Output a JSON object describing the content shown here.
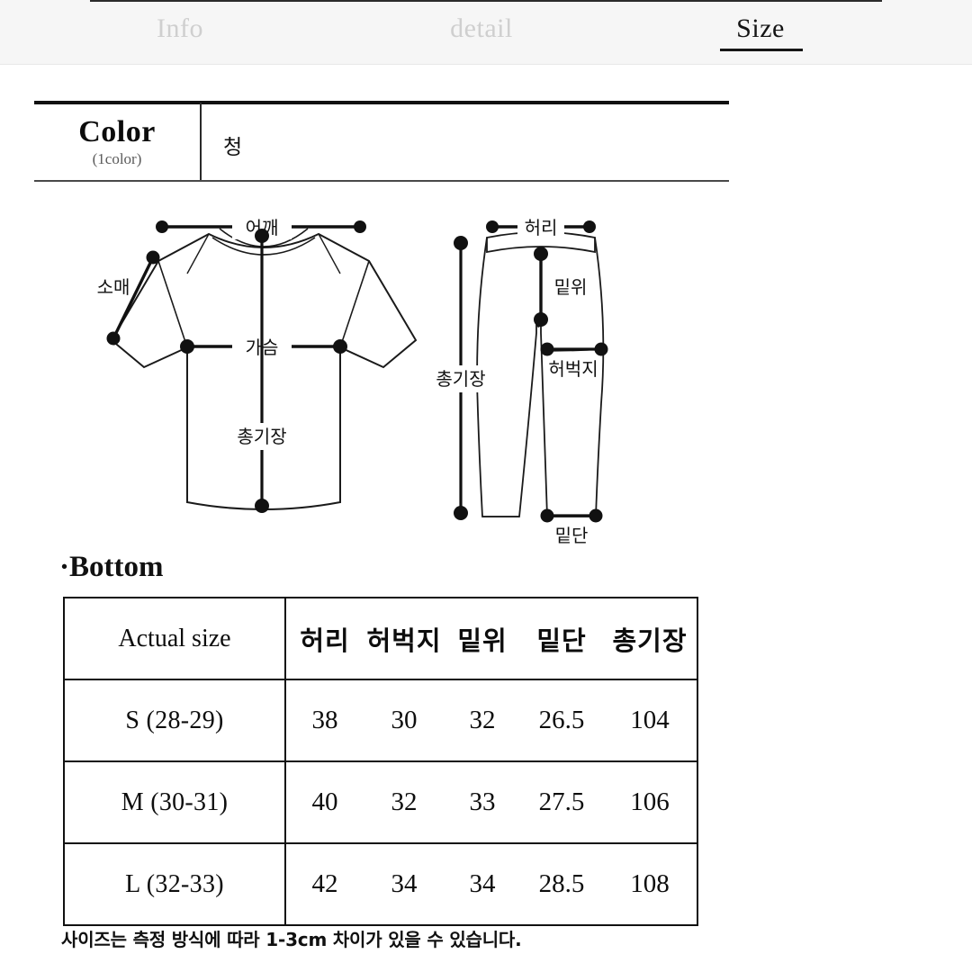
{
  "tabs": [
    {
      "label": "Info",
      "active": false
    },
    {
      "label": "detail",
      "active": false
    },
    {
      "label": "Size",
      "active": true
    }
  ],
  "color_section": {
    "title": "Color",
    "subtitle": "(1color)",
    "value": "청"
  },
  "diagrams": {
    "top": {
      "name": "t-shirt-diagram",
      "labels": {
        "shoulder": "어깨",
        "sleeve": "소매",
        "chest": "가슴",
        "total_length": "총기장"
      }
    },
    "bottom": {
      "name": "pants-diagram",
      "labels": {
        "waist": "허리",
        "rise": "밑위",
        "thigh": "허벅지",
        "hem": "밑단",
        "total_length": "총기장"
      }
    }
  },
  "size_section": {
    "title": "·Bottom",
    "header": {
      "label": "Actual size",
      "metrics": [
        "허리",
        "허벅지",
        "밑위",
        "밑단",
        "총기장"
      ]
    },
    "rows": [
      {
        "size": "S (28-29)",
        "values": [
          "38",
          "30",
          "32",
          "26.5",
          "104"
        ]
      },
      {
        "size": "M (30-31)",
        "values": [
          "40",
          "32",
          "33",
          "27.5",
          "106"
        ]
      },
      {
        "size": "L (32-33)",
        "values": [
          "42",
          "34",
          "34",
          "28.5",
          "108"
        ]
      }
    ]
  },
  "footnote": "사이즈는 측정 방식에 따라 1-3cm 차이가 있을 수 있습니다.",
  "colors": {
    "line": "#111111",
    "muted_text": "#cfcfcf",
    "tabbar_bg": "#f6f6f6"
  }
}
